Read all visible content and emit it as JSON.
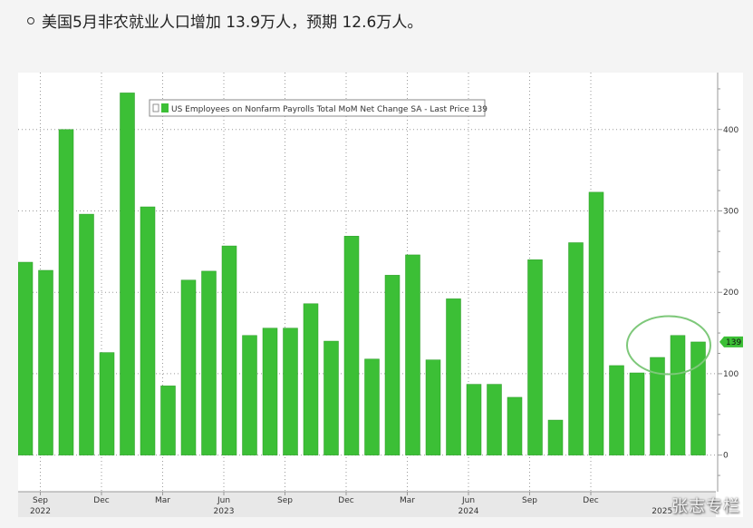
{
  "headline": {
    "text": "美国5月非农就业人口增加 13.9万人，预期 12.6万人。"
  },
  "watermark": "张志专栏",
  "chart_data": {
    "type": "bar",
    "legend_label": "US Employees on Nonfarm Payrolls Total MoM Net Change SA - Last Price 139",
    "last_value_label": "139",
    "values": [
      237,
      227,
      400,
      296,
      126,
      445,
      305,
      85,
      215,
      226,
      257,
      147,
      156,
      156,
      186,
      140,
      269,
      118,
      221,
      246,
      117,
      192,
      87,
      87,
      71,
      240,
      43,
      261,
      323,
      110,
      101,
      120,
      147,
      139
    ],
    "yticks": [
      0,
      100,
      200,
      300,
      400
    ],
    "ylim": [
      -45,
      470
    ],
    "month_ticks": [
      {
        "index": 1,
        "label": "Sep"
      },
      {
        "index": 4,
        "label": "Dec"
      },
      {
        "index": 7,
        "label": "Mar"
      },
      {
        "index": 10,
        "label": "Jun"
      },
      {
        "index": 13,
        "label": "Sep"
      },
      {
        "index": 16,
        "label": "Dec"
      },
      {
        "index": 19,
        "label": "Mar"
      },
      {
        "index": 22,
        "label": "Jun"
      },
      {
        "index": 25,
        "label": "Sep"
      },
      {
        "index": 28,
        "label": "Dec"
      }
    ],
    "year_ticks": [
      {
        "index": 1,
        "label": "2022"
      },
      {
        "index": 10,
        "label": "2023"
      },
      {
        "index": 22,
        "label": "2024"
      },
      {
        "index": 31.5,
        "label": "2025"
      }
    ],
    "colors": {
      "bar": "#3cbf36",
      "bar_edge": "#2a9a26",
      "highlight_circle": "#7ec87a",
      "grid": "#9a9a9a"
    }
  }
}
